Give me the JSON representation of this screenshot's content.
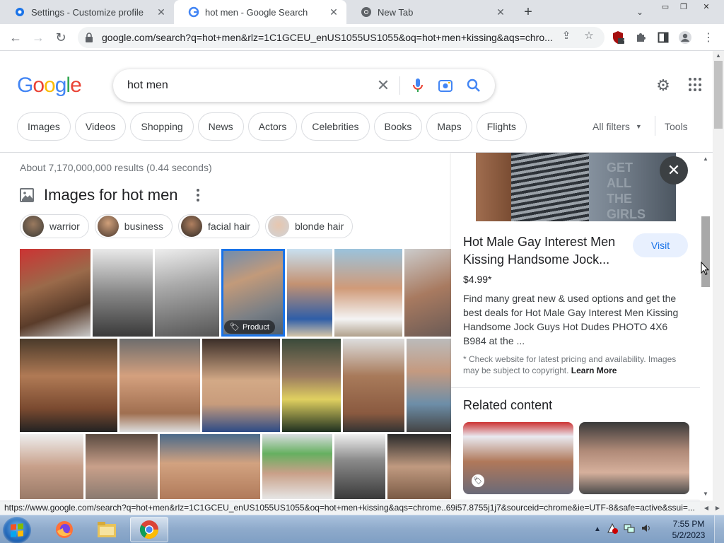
{
  "browser": {
    "tabs": [
      {
        "title": "Settings - Customize profile",
        "icon": "gear-icon"
      },
      {
        "title": "hot men - Google Search",
        "icon": "google-icon"
      },
      {
        "title": "New Tab",
        "icon": "chrome-icon"
      }
    ],
    "url": "google.com/search?q=hot+men&rlz=1C1GCEU_enUS1055US1055&oq=hot+men+kissing&aqs=chro...",
    "extension_badge": "7"
  },
  "google": {
    "logo": "Google",
    "query": "hot men",
    "chips": [
      "Images",
      "Videos",
      "Shopping",
      "News",
      "Actors",
      "Celebrities",
      "Books",
      "Maps",
      "Flights"
    ],
    "all_filters": "All filters",
    "tools": "Tools",
    "results_count": "About 7,170,000,000 results (0.44 seconds)",
    "images_heading": "Images for hot men",
    "refine": [
      "warrior",
      "business",
      "facial hair",
      "blonde hair"
    ],
    "product_badge": "Product"
  },
  "panel": {
    "title": "Hot Male Gay Interest Men Kissing Handsome Jock...",
    "visit": "Visit",
    "price": "$4.99*",
    "description": "Find many great new & used options and get the best deals for Hot Male Gay Interest Men Kissing Handsome Jock Guys Hot Dudes PHOTO 4X6 B984 at the ...",
    "note": "* Check website for latest pricing and availability. Images may be subject to copyright.",
    "learn_more": "Learn More",
    "related_heading": "Related content",
    "shirt_text": "GET\nALL\nTHE\nGIRLS"
  },
  "status_url": "https://www.google.com/search?q=hot+men&rlz=1C1GCEU_enUS1055US1055&oq=hot+men+kissing&aqs=chrome..69i57.8755j1j7&sourceid=chrome&ie=UTF-8&safe=active&ssui=...",
  "taskbar": {
    "time": "7:55 PM",
    "date": "5/2/2023"
  },
  "colors": {
    "google_blue": "#4285f4",
    "google_red": "#ea4335",
    "google_yellow": "#fbbc05",
    "google_green": "#34a853",
    "link_blue": "#1a73e8"
  }
}
